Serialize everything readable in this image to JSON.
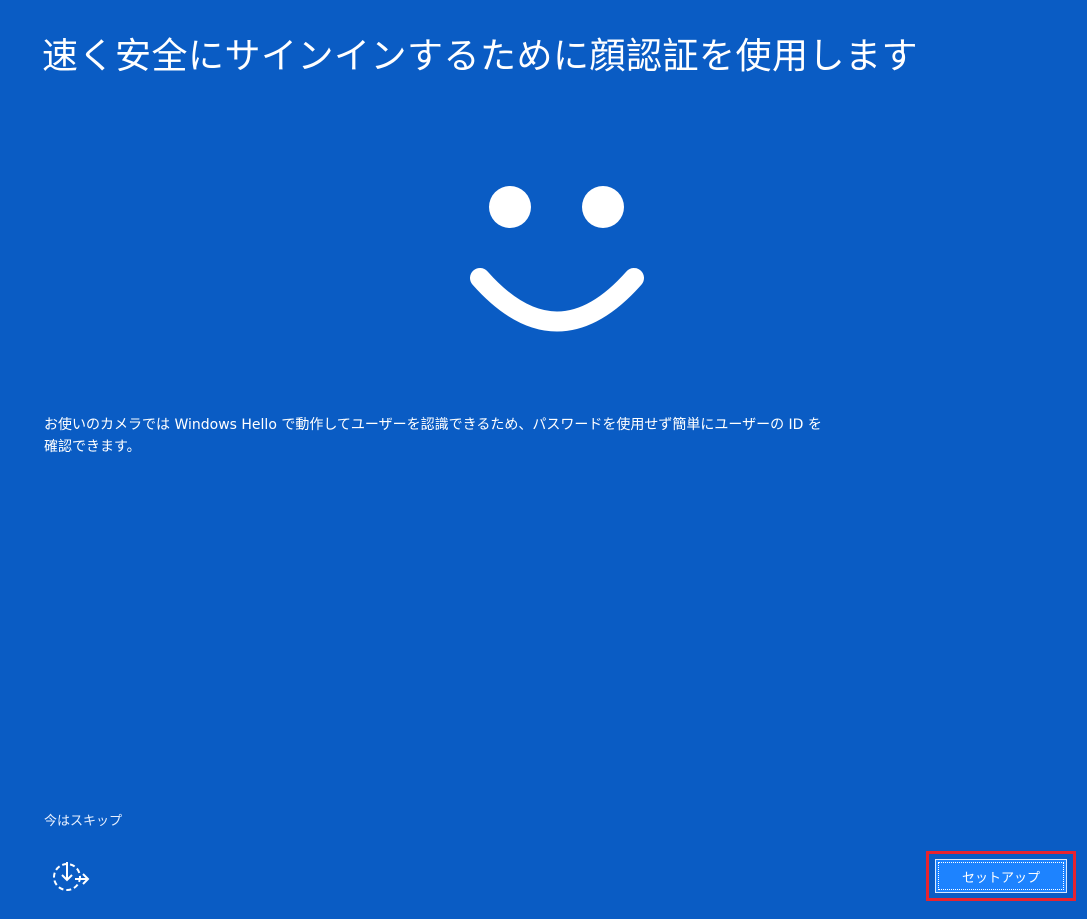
{
  "page": {
    "title": "速く安全にサインインするために顔認証を使用します",
    "description": "お使いのカメラでは Windows Hello で動作してユーザーを認識できるため、パスワードを使用せず簡単にユーザーの ID を確認できます。"
  },
  "icons": {
    "hello_face": "smiley-face-icon",
    "accessibility": "accessibility-icon"
  },
  "actions": {
    "skip_label": "今はスキップ",
    "setup_label": "セットアップ"
  },
  "colors": {
    "background": "#0a5cc4",
    "button": "#1d83ff",
    "highlight": "#e8232f"
  }
}
